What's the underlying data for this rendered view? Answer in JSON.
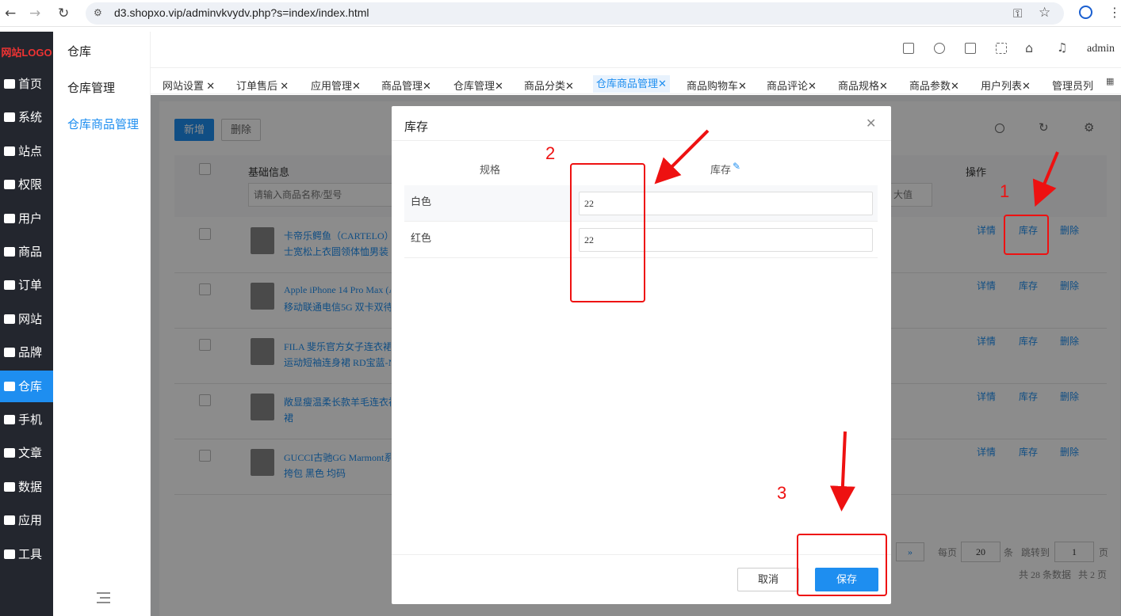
{
  "browser": {
    "url": "d3.shopxo.vip/adminvkvydv.php?s=index/index.html"
  },
  "logo": "网站LOGO",
  "leftnav": [
    {
      "label": "首页"
    },
    {
      "label": "系统"
    },
    {
      "label": "站点"
    },
    {
      "label": "权限"
    },
    {
      "label": "用户"
    },
    {
      "label": "商品"
    },
    {
      "label": "订单"
    },
    {
      "label": "网站"
    },
    {
      "label": "品牌"
    },
    {
      "label": "仓库"
    },
    {
      "label": "手机"
    },
    {
      "label": "文章"
    },
    {
      "label": "数据"
    },
    {
      "label": "应用"
    },
    {
      "label": "工具"
    }
  ],
  "subnav": {
    "title": "仓库",
    "items": [
      "仓库管理",
      "仓库商品管理"
    ]
  },
  "header": {
    "user": "admin"
  },
  "tabs": [
    "网站设置 ✕",
    "订单售后 ✕",
    "应用管理✕",
    "商品管理✕",
    "仓库管理✕",
    "商品分类✕",
    "仓库商品管理✕",
    "商品购物车✕",
    "商品评论✕",
    "商品规格✕",
    "商品参数✕",
    "用户列表✕",
    "管理员列"
  ],
  "toolbar": {
    "add": "新增",
    "delete": "删除"
  },
  "table": {
    "col_basic": "基础信息",
    "col_ops": "操作",
    "search_placeholder": "请输入商品名称/型号",
    "max_placeholder": "大值",
    "rows": [
      {
        "line1": "卡帝乐鳄鱼（CARTELO）",
        "line2": "士宽松上衣圆领体恤男装"
      },
      {
        "line1": "Apple iPhone 14 Pro Max (A",
        "line2": "移动联通电信5G 双卡双待"
      },
      {
        "line1": "FILA 斐乐官方女子连衣裙",
        "line2": "运动短袖连身裙 RD宝蓝-N"
      },
      {
        "line1": "敞显瘦温柔长款羊毛连衣裙",
        "line2": "裙"
      },
      {
        "line1": "GUCCI古驰GG Marmont系",
        "line2": "挎包 黑色 均码"
      }
    ],
    "ops": {
      "detail": "详情",
      "stock": "库存",
      "delete": "删除"
    }
  },
  "pager": {
    "per_page": "每页",
    "per_page_value": "20",
    "unit": "条",
    "jump": "跳转到",
    "jump_value": "1",
    "page": "页",
    "summary": "共 28 条数据   共 2 页",
    "next": "»"
  },
  "modal": {
    "title": "库存",
    "col_spec": "规格",
    "col_stock": "库存",
    "rows": [
      {
        "spec": "白色",
        "stock": "22"
      },
      {
        "spec": "红色",
        "stock": "22"
      }
    ],
    "cancel": "取消",
    "save": "保存"
  },
  "annotations": {
    "n1": "1",
    "n2": "2",
    "n3": "3",
    "color": "#ee1111"
  },
  "colors": {
    "accent": "#1e8ef0",
    "nav_bg": "#23262e"
  }
}
